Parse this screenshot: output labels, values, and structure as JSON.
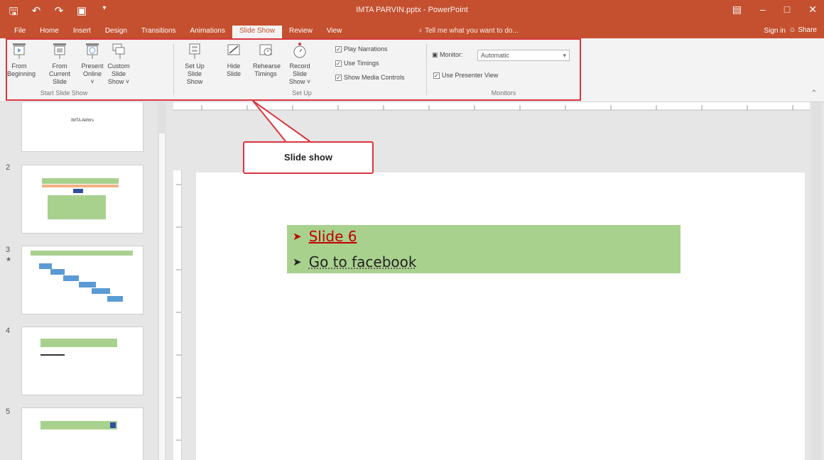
{
  "window": {
    "title": "IMTA PARVIN.pptx - PowerPoint"
  },
  "qat": {
    "save_icon": "save-icon",
    "undo_icon": "undo-icon",
    "redo_icon": "redo-icon",
    "present_icon": "present-from-beginning-icon",
    "customize_icon": "customize-qat-icon"
  },
  "tabs": [
    "File",
    "Home",
    "Insert",
    "Design",
    "Transitions",
    "Animations",
    "Slide Show",
    "Review",
    "View"
  ],
  "active_tab": "Slide Show",
  "tell_me": "♀ Tell me what you want to do...",
  "account": {
    "sign_in": "Sign in",
    "share": "Share"
  },
  "ribbon": {
    "start_group": {
      "title": "Start Slide Show",
      "from_beginning": "From Beginning",
      "from_current": "From Current Slide",
      "present_online": "Present Online ˅",
      "custom_show": "Custom Slide Show ˅"
    },
    "setup_group": {
      "title": "Set Up",
      "setup_show": "Set Up Slide Show",
      "hide_slide": "Hide Slide",
      "rehearse": "Rehearse Timings",
      "record": "Record Slide Show ˅",
      "play_narrations": "Play Narrations",
      "use_timings": "Use Timings",
      "show_media_controls": "Show Media Controls"
    },
    "monitors_group": {
      "title": "Monitors",
      "monitor_label": "Monitor:",
      "monitor_value": "Automatic",
      "use_presenter_view": "Use Presenter View"
    }
  },
  "thumbnails": {
    "slide1_title": "IMTA Akhtrs",
    "nums": [
      "2",
      "3",
      "4",
      "5"
    ],
    "star": "★"
  },
  "slide": {
    "bullet1": "Slide 6",
    "bullet2": "Go to facebook"
  },
  "callout": {
    "text": "Slide show"
  },
  "colors": {
    "accent": "#c4502f",
    "highlight_box": "#d9363e",
    "textbox_fill": "#a9d18e"
  }
}
